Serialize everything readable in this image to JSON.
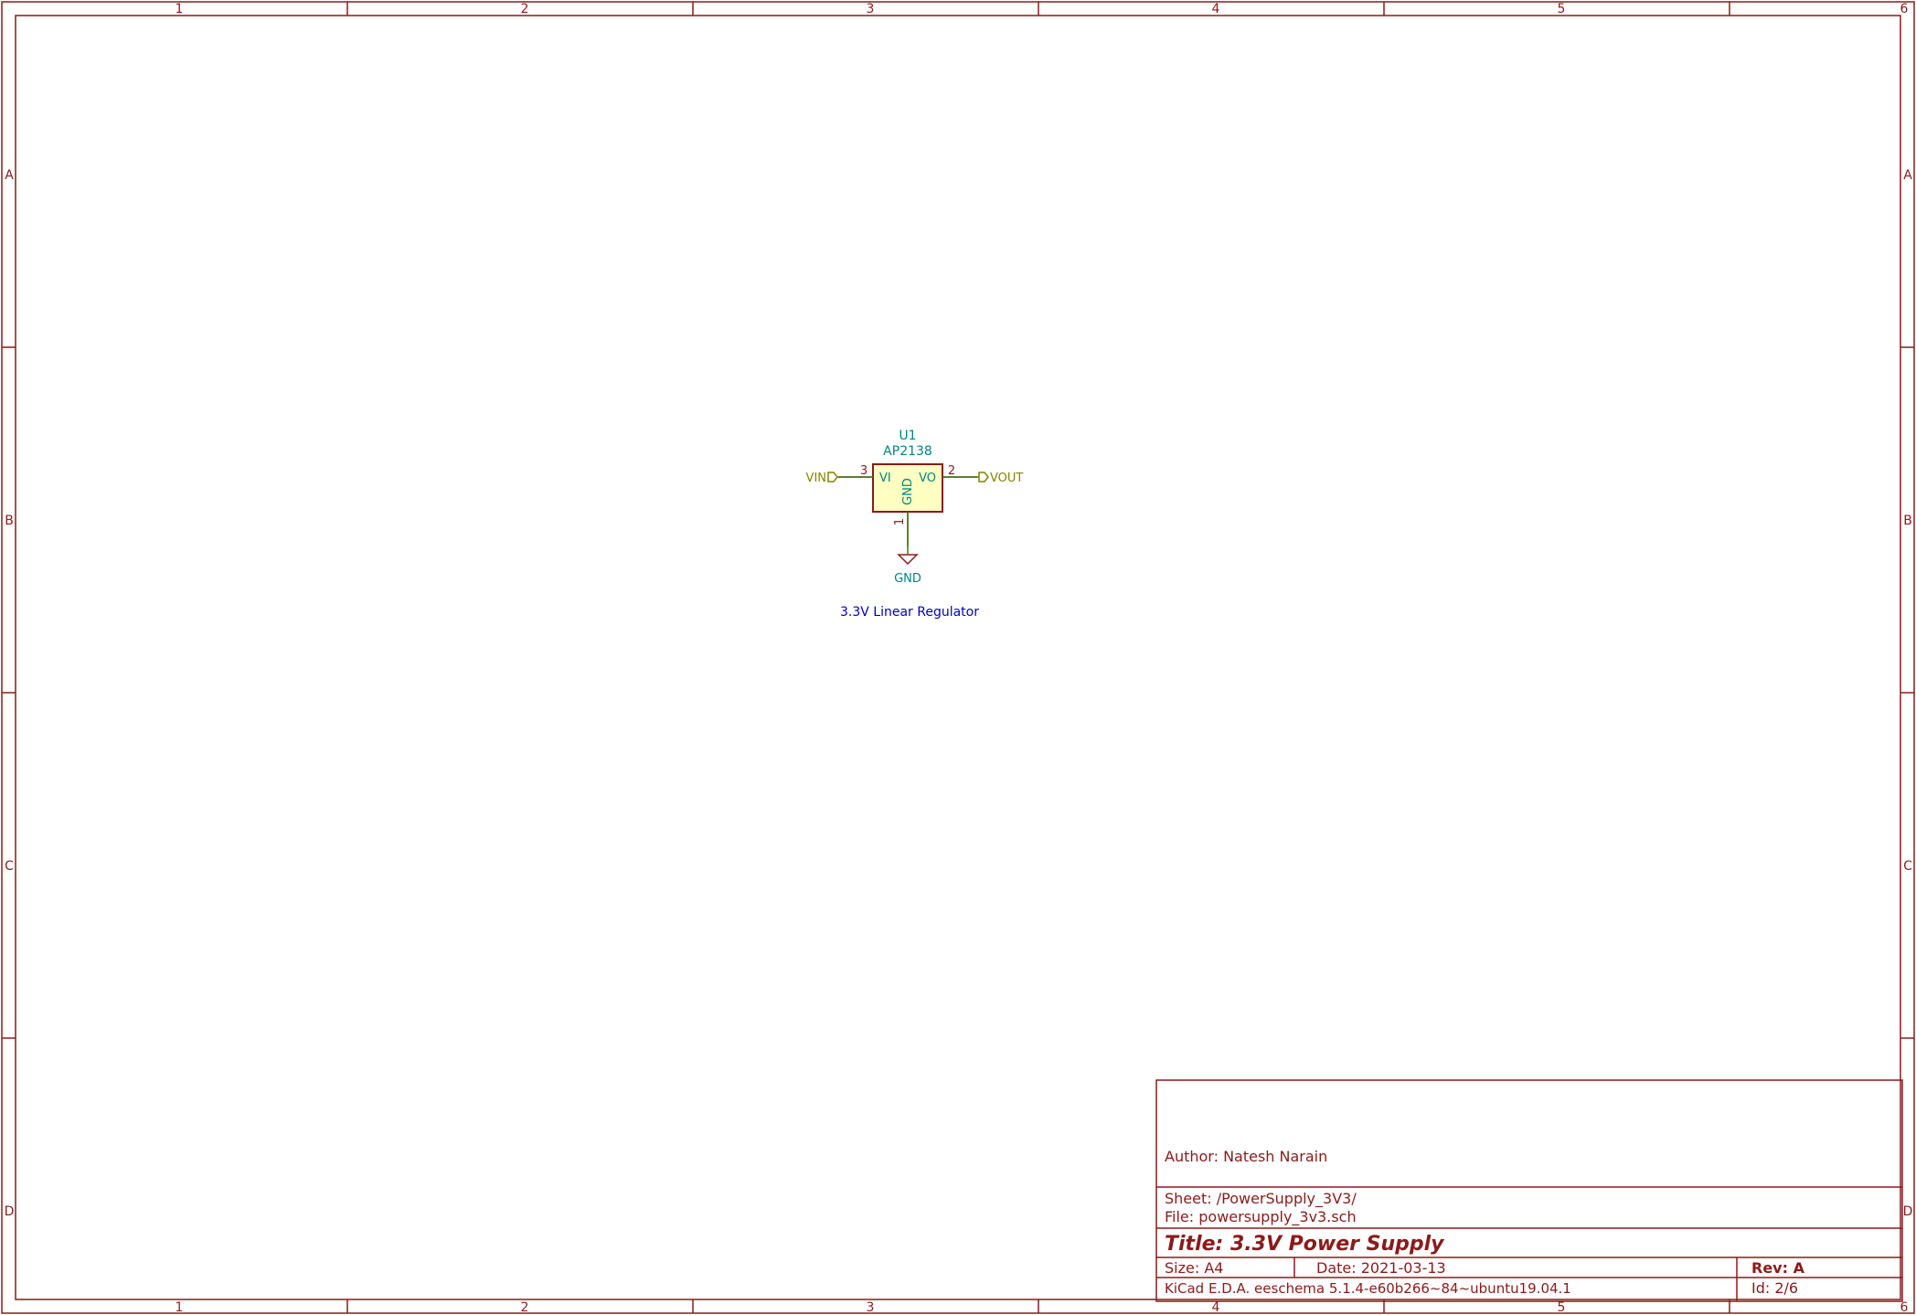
{
  "colors": {
    "border": "#8b1a1a",
    "component_body": "#ffffc2",
    "component_outline": "#8b1a1a",
    "ref_text": "#008484",
    "wire": "#3a7a1a",
    "net_label": "#848400",
    "note_text": "#0000c2",
    "titleblock_text": "#8b1a1a"
  },
  "border": {
    "columns": [
      "1",
      "2",
      "3",
      "4",
      "5",
      "6"
    ],
    "rows": [
      "A",
      "B",
      "C",
      "D"
    ]
  },
  "schematic": {
    "component": {
      "reference": "U1",
      "value": "AP2138",
      "pin_left_name": "VI",
      "pin_right_name": "VO",
      "pin_bottom_name": "GND",
      "pin_left_number": "3",
      "pin_right_number": "2",
      "pin_bottom_number": "1"
    },
    "net_in": "VIN",
    "net_out": "VOUT",
    "ground_label": "GND",
    "note": "3.3V Linear Regulator"
  },
  "title_block": {
    "author": "Author: Natesh Narain",
    "sheet": "Sheet: /PowerSupply_3V3/",
    "file": "File: powersupply_3v3.sch",
    "title": "Title: 3.3V Power Supply",
    "size": "Size: A4",
    "date": "Date: 2021-03-13",
    "rev": "Rev: A",
    "tool": "KiCad E.D.A.  eeschema 5.1.4-e60b266~84~ubuntu19.04.1",
    "id": "Id: 2/6"
  }
}
